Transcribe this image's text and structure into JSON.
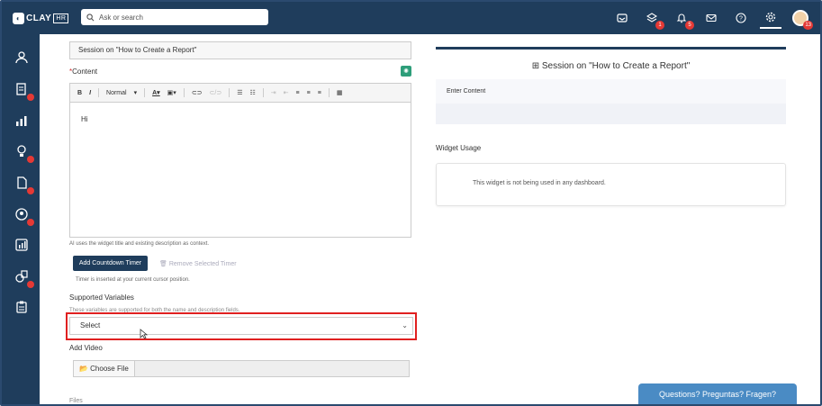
{
  "app": {
    "logo_text": "CLAY",
    "logo_suffix": "HR"
  },
  "search": {
    "placeholder": "Ask or search"
  },
  "topbar": {
    "badges": {
      "tasks": "1",
      "notifications": "5",
      "avatar": "13"
    }
  },
  "form": {
    "title_value": "Session on \"How to Create a Report\"",
    "content_label": "Content",
    "required_mark": "*",
    "toolbar": {
      "bold": "B",
      "italic": "I",
      "format": "Normal"
    },
    "editor_text": "Hi",
    "ai_note": "AI uses the widget title and existing description as context.",
    "add_countdown_label": "Add Countdown Timer",
    "remove_timer_label": "Remove Selected Timer",
    "timer_note": "Timer is inserted at your current cursor position.",
    "supported_variables_label": "Supported Variables",
    "supported_variables_help": "These variables are supported for both the name and description fields.",
    "select_value": "Select",
    "add_video_label": "Add Video",
    "choose_file_label": "Choose File",
    "file_label_cut": "Files"
  },
  "preview": {
    "title": "Session on \"How to Create a Report\"",
    "enter_content": "Enter Content",
    "widget_usage_label": "Widget Usage",
    "widget_usage_text": "This widget is not being used in any dashboard."
  },
  "help_chip": "Questions? Preguntas? Fragen?",
  "colors": {
    "nav": "#1f3d5c",
    "accent": "#2e9e7a",
    "highlight": "#e02020",
    "badge": "#e53935"
  }
}
